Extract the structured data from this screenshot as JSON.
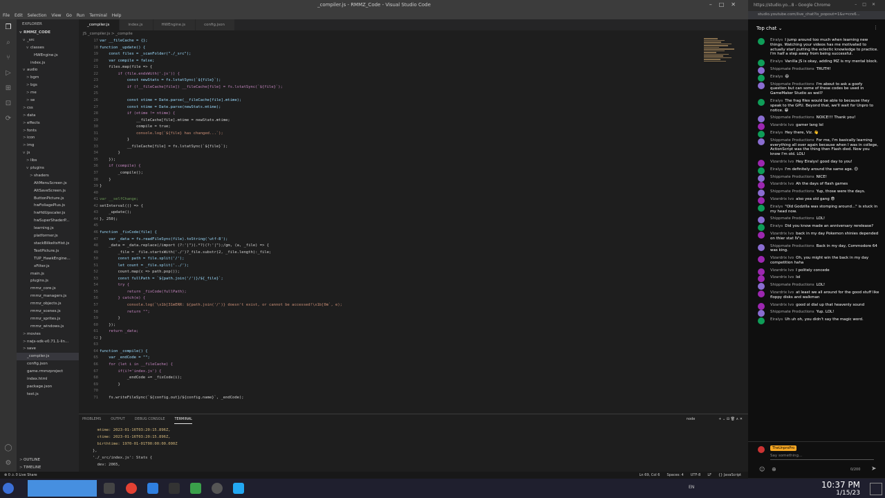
{
  "vscode": {
    "window_title": "_compiler.js - RMMZ_Code - Visual Studio Code",
    "menu": [
      "File",
      "Edit",
      "Selection",
      "View",
      "Go",
      "Run",
      "Terminal",
      "Help"
    ],
    "explorer_title": "EXPLORER",
    "project": "RMMZ_CODE",
    "tree": [
      {
        "label": "_src",
        "indent": 1,
        "chev": "v"
      },
      {
        "label": "classes",
        "indent": 2,
        "chev": "v"
      },
      {
        "label": "HWEngine.js",
        "indent": 3,
        "chev": ""
      },
      {
        "label": "index.js",
        "indent": 2,
        "chev": ""
      },
      {
        "label": "audio",
        "indent": 1,
        "chev": "v"
      },
      {
        "label": "bgm",
        "indent": 2,
        "chev": ">"
      },
      {
        "label": "bgs",
        "indent": 2,
        "chev": ">"
      },
      {
        "label": "me",
        "indent": 2,
        "chev": ">"
      },
      {
        "label": "se",
        "indent": 2,
        "chev": ">"
      },
      {
        "label": "css",
        "indent": 1,
        "chev": ">"
      },
      {
        "label": "data",
        "indent": 1,
        "chev": ">"
      },
      {
        "label": "effects",
        "indent": 1,
        "chev": ">"
      },
      {
        "label": "fonts",
        "indent": 1,
        "chev": ">"
      },
      {
        "label": "icon",
        "indent": 1,
        "chev": ">"
      },
      {
        "label": "img",
        "indent": 1,
        "chev": ">"
      },
      {
        "label": "js",
        "indent": 1,
        "chev": "v"
      },
      {
        "label": "libs",
        "indent": 2,
        "chev": ">"
      },
      {
        "label": "plugins",
        "indent": 2,
        "chev": "v"
      },
      {
        "label": "shaders",
        "indent": 3,
        "chev": ">"
      },
      {
        "label": "AltMenuScreen.js",
        "indent": 3,
        "chev": ""
      },
      {
        "label": "AltSaveScreen.js",
        "indent": 3,
        "chev": ""
      },
      {
        "label": "ButtonPicture.js",
        "indent": 3,
        "chev": ""
      },
      {
        "label": "hwFoliagePlus.js",
        "indent": 3,
        "chev": ""
      },
      {
        "label": "hwHdUpscaler.js",
        "indent": 3,
        "chev": ""
      },
      {
        "label": "hwSuperShaderP...",
        "indent": 3,
        "chev": ""
      },
      {
        "label": "learning.js",
        "indent": 3,
        "chev": ""
      },
      {
        "label": "platformer.js",
        "indent": 3,
        "chev": ""
      },
      {
        "label": "stackBilkeltsHist.js",
        "indent": 3,
        "chev": ""
      },
      {
        "label": "TextPicture.js",
        "indent": 3,
        "chev": ""
      },
      {
        "label": "TUP_HawkEngine...",
        "indent": 3,
        "chev": ""
      },
      {
        "label": "xFilter.js",
        "indent": 3,
        "chev": ""
      },
      {
        "label": "main.js",
        "indent": 2,
        "chev": ""
      },
      {
        "label": "plugins.js",
        "indent": 2,
        "chev": ""
      },
      {
        "label": "rmmz_core.js",
        "indent": 2,
        "chev": ""
      },
      {
        "label": "rmmz_managers.js",
        "indent": 2,
        "chev": ""
      },
      {
        "label": "rmmz_objects.js",
        "indent": 2,
        "chev": ""
      },
      {
        "label": "rmmz_scenes.js",
        "indent": 2,
        "chev": ""
      },
      {
        "label": "rmmz_sprites.js",
        "indent": 2,
        "chev": ""
      },
      {
        "label": "rmmz_windows.js",
        "indent": 2,
        "chev": ""
      },
      {
        "label": "movies",
        "indent": 1,
        "chev": ">"
      },
      {
        "label": "nwjs-sdk-v0.71.1-lin...",
        "indent": 1,
        "chev": ">"
      },
      {
        "label": "save",
        "indent": 1,
        "chev": ">"
      },
      {
        "label": "_compiler.js",
        "indent": 1,
        "chev": "",
        "sel": true
      },
      {
        "label": "config.json",
        "indent": 1,
        "chev": ""
      },
      {
        "label": "game.rmmzproject",
        "indent": 1,
        "chev": ""
      },
      {
        "label": "index.html",
        "indent": 1,
        "chev": ""
      },
      {
        "label": "package.json",
        "indent": 1,
        "chev": ""
      },
      {
        "label": "test.js",
        "indent": 1,
        "chev": ""
      }
    ],
    "outline": "OUTLINE",
    "timeline": "TIMELINE",
    "tabs": [
      {
        "label": "_compiler.js",
        "active": true
      },
      {
        "label": "index.js",
        "active": false
      },
      {
        "label": "HWEngine.js",
        "active": false
      },
      {
        "label": "config.json",
        "active": false
      }
    ],
    "breadcrumb": "JS _compiler.js > _compile",
    "code_lines": [
      {
        "n": "17",
        "t": "var __fileCache = {};"
      },
      {
        "n": "18",
        "t": "function _update() {"
      },
      {
        "n": "19",
        "t": "    const files = _scanFolder(\"./_src\");"
      },
      {
        "n": "20",
        "t": "    var compile = false;"
      },
      {
        "n": "21",
        "t": "    files.map(file => {"
      },
      {
        "n": "22",
        "t": "        if (file.endsWith('.js')) {"
      },
      {
        "n": "23",
        "t": "            const newStats = fs.lstatSync(`${file}`);"
      },
      {
        "n": "24",
        "t": "            if (!__fileCache[file]) __fileCache[file] = fs.lstatSync(`${file}`);"
      },
      {
        "n": "25",
        "t": ""
      },
      {
        "n": "26",
        "t": "            const otime = Date.parse(__fileCache[file].mtime);"
      },
      {
        "n": "27",
        "t": "            const ntime = Date.parse(newStats.mtime);"
      },
      {
        "n": "28",
        "t": "            if (otime != ntime) {"
      },
      {
        "n": "29",
        "t": "                __fileCache[file].mtime = newStats.mtime;"
      },
      {
        "n": "30",
        "t": "                compile = true;"
      },
      {
        "n": "31",
        "t": "                console.log(`${file} has changed...`);"
      },
      {
        "n": "32",
        "t": "            }"
      },
      {
        "n": "33",
        "t": "            __fileCache[file] = fs.lstatSync(`${file}`);"
      },
      {
        "n": "34",
        "t": "        }"
      },
      {
        "n": "35",
        "t": "    });"
      },
      {
        "n": "36",
        "t": "    if (compile) {"
      },
      {
        "n": "37",
        "t": "        _compile();"
      },
      {
        "n": "38",
        "t": "    }"
      },
      {
        "n": "39",
        "t": "}"
      },
      {
        "n": "40",
        "t": ""
      },
      {
        "n": "41",
        "t": "var __selfChange;"
      },
      {
        "n": "42",
        "t": "setInterval(() => {"
      },
      {
        "n": "43",
        "t": "    _update();"
      },
      {
        "n": "44",
        "t": "}, 250);"
      },
      {
        "n": "45",
        "t": ""
      },
      {
        "n": "46",
        "t": "function _fixCode(file) {"
      },
      {
        "n": "47",
        "t": "    var _data = fs.readFileSync(file).toString('utf-8');"
      },
      {
        "n": "48",
        "t": "    _data = _data.replace(/import (?:'|\")(.*?)(?:'|\");/gm, (a, _file) => {"
      },
      {
        "n": "49",
        "t": "        _file = _file.startsWith('./')?_file.substr(2, _file.length):_file;"
      },
      {
        "n": "50",
        "t": "        const path = file.split('/');"
      },
      {
        "n": "51",
        "t": "        let count = _file.split('../');"
      },
      {
        "n": "52",
        "t": "        count.map(c => path.pop());"
      },
      {
        "n": "53",
        "t": "        const fullPath = `${path.join('/')}/${_file}`;"
      },
      {
        "n": "54",
        "t": "        try {"
      },
      {
        "n": "55",
        "t": "            return _fixCode(fullPath);"
      },
      {
        "n": "56",
        "t": "        } catch(e) {"
      },
      {
        "n": "57",
        "t": "            console.log(`\\x1b[31mERR: ${path.join('/')} doesn't exist, or cannot be accessed!\\x1b[0m`, e);"
      },
      {
        "n": "58",
        "t": "            return \"\";"
      },
      {
        "n": "59",
        "t": "        }"
      },
      {
        "n": "60",
        "t": "    });"
      },
      {
        "n": "61",
        "t": "    return _data;"
      },
      {
        "n": "62",
        "t": "}"
      },
      {
        "n": "63",
        "t": ""
      },
      {
        "n": "64",
        "t": "function _compile() {"
      },
      {
        "n": "65",
        "t": "    var _endCode = \"\";"
      },
      {
        "n": "66",
        "t": "    for (let i in __fileCache) {"
      },
      {
        "n": "67",
        "t": "        if(i!='index.js') {"
      },
      {
        "n": "68",
        "t": "            _endCode += _fixCode(i);"
      },
      {
        "n": "69",
        "t": "        }"
      },
      {
        "n": "70",
        "t": "    "
      },
      {
        "n": "71",
        "t": "    fs.writeFileSync(`${config.out}/${config.name}`, _endCode);"
      }
    ],
    "panel_tabs": [
      "PROBLEMS",
      "OUTPUT",
      "DEBUG CONSOLE",
      "TERMINAL"
    ],
    "panel_right": "node",
    "terminal_lines": [
      "  mtime: 2023-01-16T03:20:15.896Z,",
      "  ctime: 2023-01-16T03:20:15.896Z,",
      "  birthtime: 1970-01-01T00:00:00.000Z",
      "},",
      "'./_src/index.js': Stats {",
      "  dev: 2065,"
    ],
    "status_left": "⊗ 0 ⚠ 0   Live Share",
    "status_right": [
      "Ln 69, Col 6",
      "Spaces: 4",
      "UTF-8",
      "LF",
      "{} JavaScript"
    ]
  },
  "browser": {
    "tab_url": "https://studio.yo...8 - Google Chrome",
    "address": "studio.youtube.com/live_chat?is_popout=1&v=crx6...",
    "chat_title": "Top chat",
    "messages": [
      {
        "author": "Eiralys",
        "text": "I jump around too much when learning new things. Watching your videos has me motivated to actually start putting the eclectic knowledge to practice. I'm half a step away from being successful.",
        "color": "#0f9d58"
      },
      {
        "author": "Eiralys",
        "text": "Vanilla JS is okay, adding MZ is my mental block.",
        "color": "#0f9d58"
      },
      {
        "author": "Shippmate Productions",
        "text": "TRUTH!",
        "color": "#8a6dd1"
      },
      {
        "author": "Eiralys",
        "text": "😄",
        "color": "#0f9d58"
      },
      {
        "author": "Shippmate Productions",
        "text": "I'm about to ask a goofy question but can some of these codes be used in GameMaker Studio as well?",
        "color": "#8a6dd1"
      },
      {
        "author": "Eiralys",
        "text": "The frag files would be able to because they speak to the GPU. Beyond that, we'll wait for Unpro to notice. 😁",
        "color": "#0f9d58"
      },
      {
        "author": "Shippmate Productions",
        "text": "NOICE!!! Thank you!",
        "color": "#8a6dd1"
      },
      {
        "author": "Vizardrix Ivo",
        "text": "gamer lang lol",
        "color": "#9c27b0"
      },
      {
        "author": "Eiralys",
        "text": "Hey there, Viz. 👋",
        "color": "#0f9d58"
      },
      {
        "author": "Shippmate Productions",
        "text": "For me, I'm basically learning everything all over again because when I was in college, ActionScript was the thing then Flash died. Now you know I'm old. LOL!",
        "color": "#8a6dd1"
      },
      {
        "author": "Vizardrix Ivo",
        "text": "Hey Eiralys! good day to you!",
        "color": "#9c27b0"
      },
      {
        "author": "Eiralys",
        "text": "I'm definitely around the same age. 😊",
        "color": "#0f9d58"
      },
      {
        "author": "Shippmate Productions",
        "text": "NICE!",
        "color": "#8a6dd1"
      },
      {
        "author": "Vizardrix Ivo",
        "text": "Ah the days of flash games",
        "color": "#9c27b0"
      },
      {
        "author": "Shippmate Productions",
        "text": "Yup, those were the days.",
        "color": "#8a6dd1"
      },
      {
        "author": "Vizardrix Ivo",
        "text": "also yea old gang 😎",
        "color": "#9c27b0"
      },
      {
        "author": "Eiralys",
        "text": "\"Old Godzilla was stomping around...\" is stuck in my head now.",
        "color": "#0f9d58"
      },
      {
        "author": "Shippmate Productions",
        "text": "LOL!",
        "color": "#8a6dd1"
      },
      {
        "author": "Eiralys",
        "text": "Did you know made an anniversary rerelease?",
        "color": "#0f9d58"
      },
      {
        "author": "Vizardrix Ivo",
        "text": "back in my day Pokemon shinies depended on thier stat IV's",
        "color": "#9c27b0"
      },
      {
        "author": "Shippmate Productions",
        "text": "Back in my day, Commodore 64 was king.",
        "color": "#8a6dd1"
      },
      {
        "author": "Vizardrix Ivo",
        "text": "Oh, you might win the back in my day competition haha",
        "color": "#9c27b0"
      },
      {
        "author": "Vizardrix Ivo",
        "text": "I politely concede",
        "color": "#9c27b0"
      },
      {
        "author": "Vizardrix Ivo",
        "text": "lol",
        "color": "#9c27b0"
      },
      {
        "author": "Shippmate Productions",
        "text": "LOL!",
        "color": "#8a6dd1"
      },
      {
        "author": "Vizardrix Ivo",
        "text": "at least we all around for the good stuff like floppy disks and walkman",
        "color": "#9c27b0"
      },
      {
        "author": "Vizardrix Ivo",
        "text": "good ol dial up that heavenly sound",
        "color": "#9c27b0"
      },
      {
        "author": "Shippmate Productions",
        "text": "Yup. LOL!",
        "color": "#8a6dd1"
      },
      {
        "author": "Eiralys",
        "text": "Uh uh oh, you didn't say the magic word.",
        "color": "#0f9d58"
      }
    ],
    "input_user": "TheUnproPro",
    "input_placeholder": "Say something...",
    "char_count": "0/200"
  },
  "taskbar": {
    "time": "10:37 PM",
    "date": "1/15/23",
    "lang": "EN"
  }
}
